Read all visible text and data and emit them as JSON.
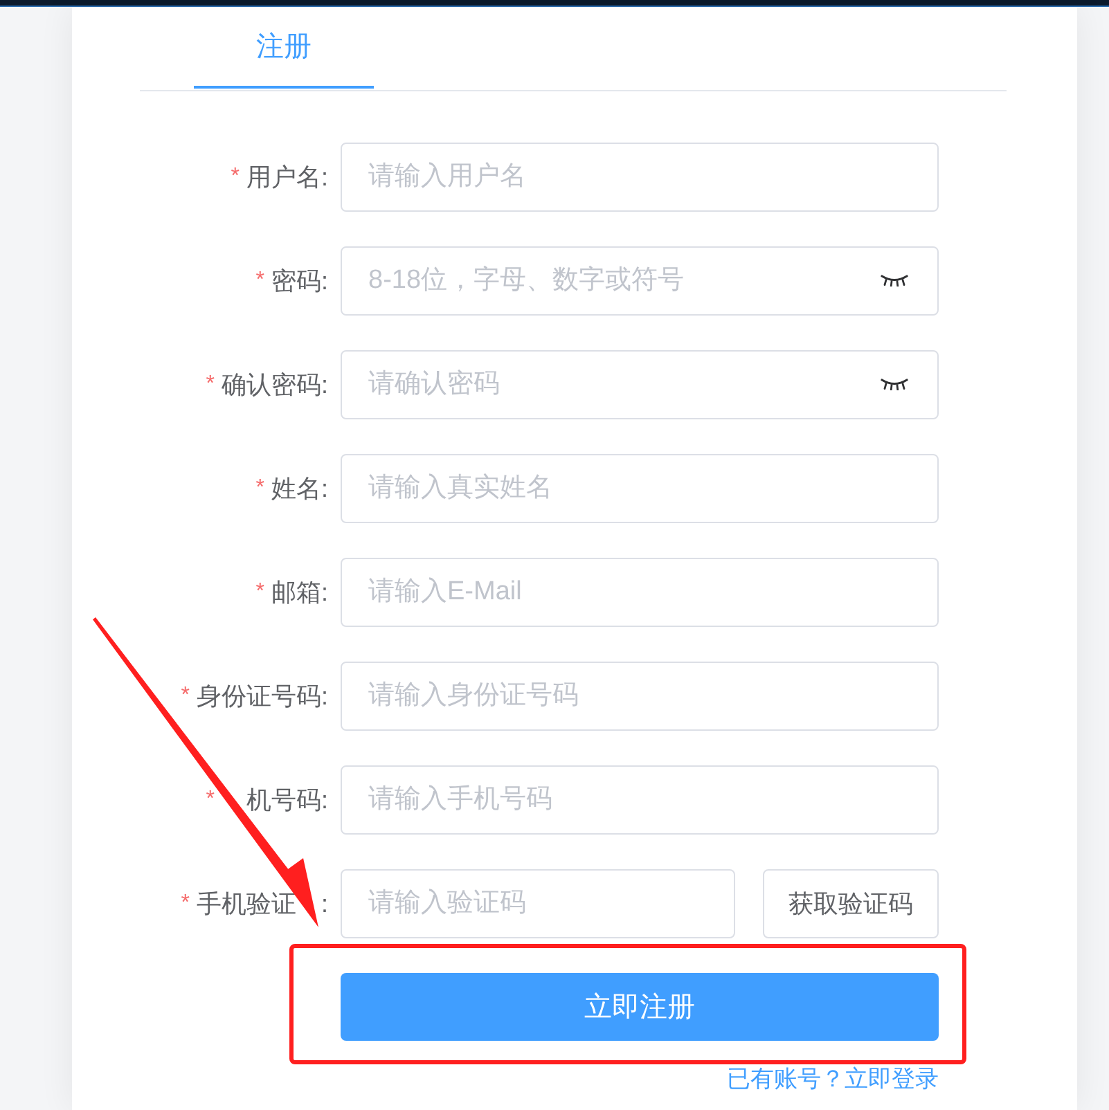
{
  "header": {
    "tabs": [
      {
        "label": "注册",
        "selected": true
      }
    ]
  },
  "form": {
    "fields": [
      {
        "required_mark": "*",
        "label": "用户名:",
        "placeholder": "请输入用户名",
        "kind": "text"
      },
      {
        "required_mark": "*",
        "label": "密码:",
        "placeholder": "8-18位，字母、数字或符号",
        "kind": "password"
      },
      {
        "required_mark": "*",
        "label": "确认密码:",
        "placeholder": "请确认密码",
        "kind": "password"
      },
      {
        "required_mark": "*",
        "label": "姓名:",
        "placeholder": "请输入真实姓名",
        "kind": "text"
      },
      {
        "required_mark": "*",
        "label": "邮箱:",
        "placeholder": "请输入E-Mail",
        "kind": "text"
      },
      {
        "required_mark": "*",
        "label": "身份证号码:",
        "placeholder": "请输入身份证号码",
        "kind": "text"
      },
      {
        "required_mark": "*",
        "label": "机号码:",
        "covered_before": true,
        "placeholder": "请输入手机号码",
        "kind": "text"
      },
      {
        "required_mark": "*",
        "label": "手机验证",
        "covered_after": true,
        "label_tail": ":",
        "placeholder": "请输入验证码",
        "kind": "code",
        "button": "获取验证码"
      }
    ],
    "submit_button": "立即注册",
    "login_link": "已有账号？立即登录"
  }
}
